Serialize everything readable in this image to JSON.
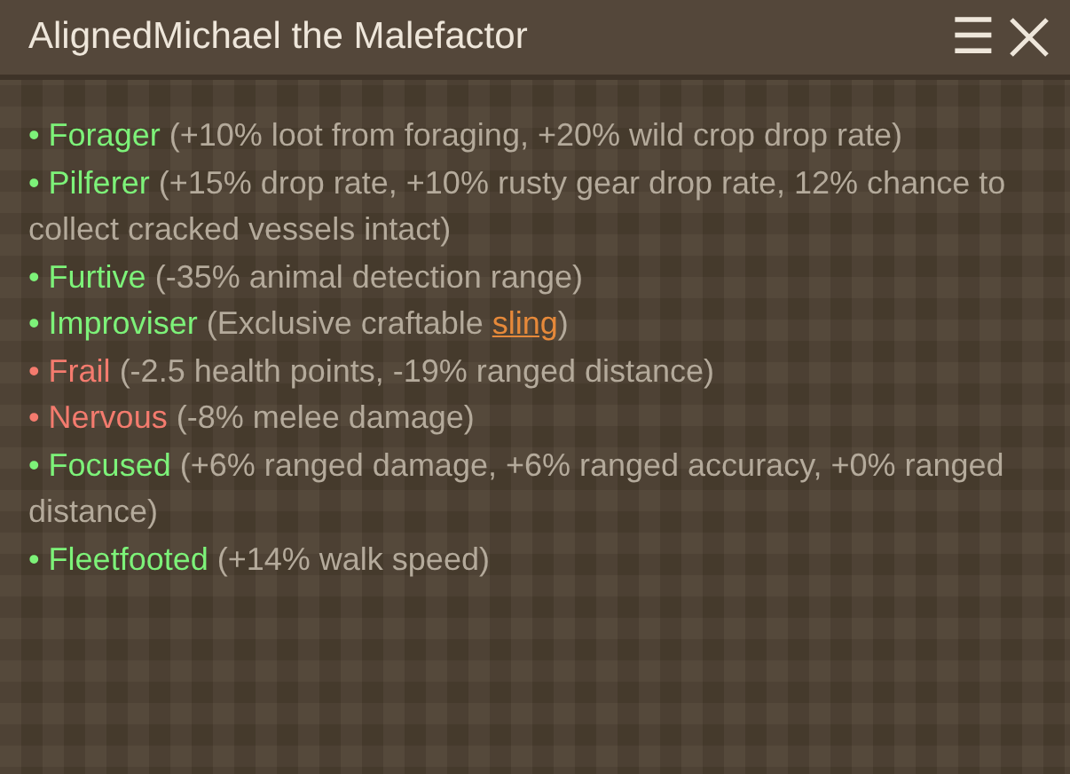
{
  "window": {
    "title": "AlignedMichael the Malefactor",
    "menu_icon": "☰"
  },
  "traits": [
    {
      "marker": "•",
      "kind": "positive",
      "name": "Forager",
      "details": "(+10% loot from foraging, +20% wild crop drop rate)"
    },
    {
      "marker": "•",
      "kind": "positive",
      "name": "Pilferer",
      "details": "(+15% drop rate, +10% rusty gear drop rate, 12% chance to collect cracked vessels intact)"
    },
    {
      "marker": "•",
      "kind": "positive",
      "name": "Furtive",
      "details": "(-35% animal detection range)"
    },
    {
      "marker": "•",
      "kind": "positive",
      "name": "Improviser",
      "details": "(Exclusive craftable ",
      "link": "sling",
      "details_after": ")"
    },
    {
      "marker": "•",
      "kind": "negative",
      "name": "Frail",
      "details": "(-2.5 health points, -19% ranged distance)"
    },
    {
      "marker": "•",
      "kind": "negative",
      "name": "Nervous",
      "details": "(-8% melee damage)"
    },
    {
      "marker": "•",
      "kind": "positive",
      "name": "Focused",
      "details": "(+6% ranged damage, +6% ranged accuracy, +0% ranged distance)"
    },
    {
      "marker": "•",
      "kind": "positive",
      "name": "Fleetfooted",
      "details": "(+14% walk speed)"
    }
  ]
}
